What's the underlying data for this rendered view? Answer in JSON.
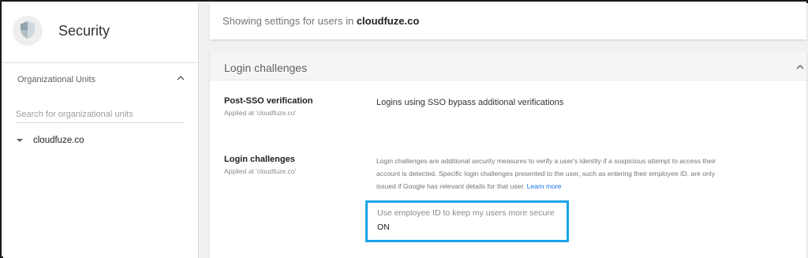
{
  "app": {
    "title": "Security",
    "icon": "shield-icon"
  },
  "sidebar": {
    "ou_title": "Organizational Units",
    "search_placeholder": "Search for organizational units",
    "tree": [
      {
        "label": "cloudfuze.co",
        "expanded": true
      }
    ]
  },
  "info": {
    "prefix": "Showing settings for users in ",
    "domain": "cloudfuze.co"
  },
  "panel": {
    "title": "Login challenges",
    "settings": {
      "post_sso": {
        "name": "Post-SSO verification",
        "applied": "Applied at 'cloudfuze.co'",
        "value": "Logins using SSO bypass additional verifications"
      },
      "login_challenges": {
        "name": "Login challenges",
        "applied": "Applied at 'cloudfuze.co'",
        "description": "Login challenges are additional security measures to verify a user's identity if a suspicious attempt to access their account is detected. Specific login challenges presented to the user, such as entering their employee ID, are only issued if Google has relevant details for that user.",
        "learn_more": "Learn more",
        "toggle_label": "Use employee ID to keep my users more secure",
        "toggle_state": "ON"
      }
    }
  },
  "colors": {
    "highlight": "#1aa3e8",
    "link": "#1a73e8"
  }
}
